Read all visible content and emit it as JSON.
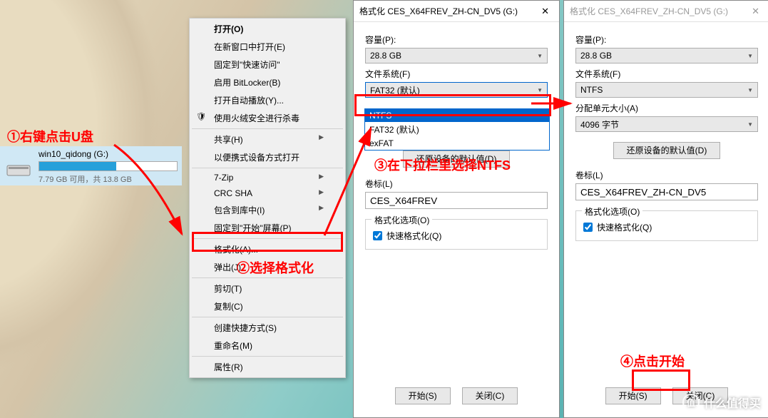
{
  "annotations": {
    "step1": "①右键点击U盘",
    "step2": "②选择格式化",
    "step3": "③在下拉栏里选择NTFS",
    "step4": "④点击开始"
  },
  "drive": {
    "name": "win10_qidong (G:)",
    "size_text": "7.79 GB 可用，共 13.8 GB"
  },
  "context_menu": {
    "open": "打开(O)",
    "open_new_window": "在新窗口中打开(E)",
    "pin_quick": "固定到\"快速访问\"",
    "bitlocker": "启用 BitLocker(B)",
    "autoplay": "打开自动播放(Y)...",
    "huorong": "使用火绒安全进行杀毒",
    "share": "共享(H)",
    "portable": "以便携式设备方式打开",
    "sevenzip": "7-Zip",
    "crcsha": "CRC SHA",
    "library": "包含到库中(I)",
    "pin_start": "固定到\"开始\"屏幕(P)",
    "format": "格式化(A)...",
    "eject": "弹出(J)",
    "cut": "剪切(T)",
    "copy": "复制(C)",
    "shortcut": "创建快捷方式(S)",
    "rename": "重命名(M)",
    "properties": "属性(R)"
  },
  "format_dialog": {
    "title_prefix": "格式化 CES_X64FREV_ZH-CN_DV5 (G:)",
    "capacity_label": "容量(P):",
    "capacity_value": "28.8 GB",
    "filesystem_label": "文件系统(F)",
    "fs_fat32": "FAT32 (默认)",
    "fs_ntfs": "NTFS",
    "fs_exfat": "exFAT",
    "alloc_label": "分配单元大小(A)",
    "alloc_value": "4096 字节",
    "restore_defaults": "还原设备的默认值(D)",
    "volume_label": "卷标(L)",
    "volume1": "CES_X64FREV",
    "volume2": "CES_X64FREV_ZH-CN_DV5",
    "options_label": "格式化选项(O)",
    "quick_format": "快速格式化(Q)",
    "start": "开始(S)",
    "close": "关闭(C)"
  },
  "watermark": "什么值得买"
}
